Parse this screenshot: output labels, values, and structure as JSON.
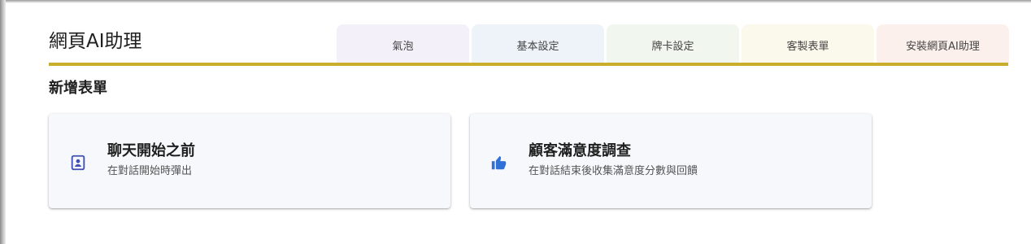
{
  "app": {
    "title": "網頁AI助理"
  },
  "tabs": [
    {
      "label": "氣泡",
      "bg": "#f3f0fa"
    },
    {
      "label": "基本設定",
      "bg": "#eef3fa"
    },
    {
      "label": "牌卡設定",
      "bg": "#f1f7ef"
    },
    {
      "label": "客製表單",
      "bg": "#fbf9ec"
    },
    {
      "label": "安裝網頁AI助理",
      "bg": "#fcf0ec"
    }
  ],
  "section": {
    "title": "新增表單"
  },
  "cards": [
    {
      "title": "聊天開始之前",
      "description": "在對話開始時彈出",
      "icon": "contact-card-icon"
    },
    {
      "title": "顧客滿意度調查",
      "description": "在對話結束後收集滿意度分數與回饋",
      "icon": "thumbs-up-icon"
    }
  ],
  "colors": {
    "accent_divider": "#c9ae2e",
    "icon_indigo": "#3f4fb5",
    "icon_blue": "#2f6fd6",
    "card_background": "#f6f8fb"
  }
}
